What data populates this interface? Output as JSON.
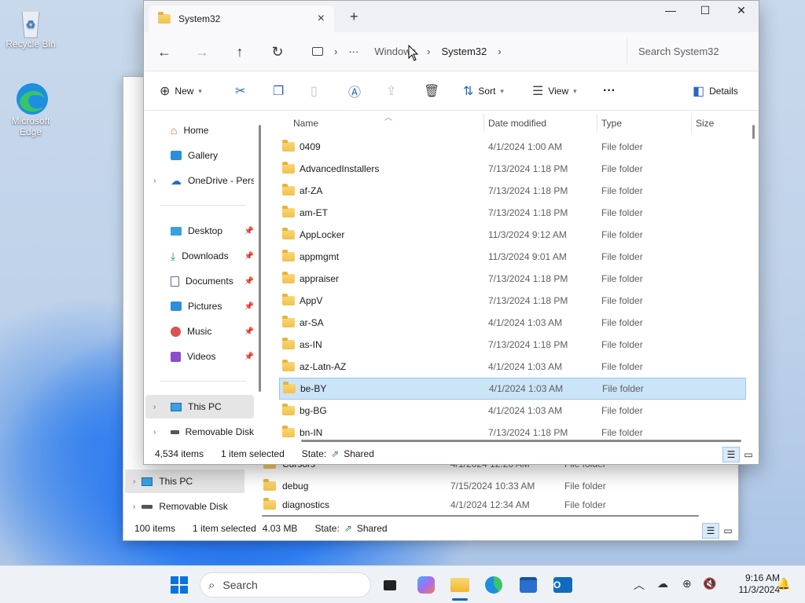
{
  "desktop": {
    "icons": [
      {
        "label": "Recycle Bin",
        "icon": "recycle-bin-icon"
      },
      {
        "label": "Microsoft Edge",
        "icon": "edge-icon"
      }
    ]
  },
  "back_window": {
    "nav": [
      {
        "label": "This PC",
        "icon": "this-pc-icon",
        "selected": true
      },
      {
        "label": "Removable Disk",
        "icon": "drive-icon",
        "selected": false
      }
    ],
    "files": [
      {
        "name": "Cursors",
        "date": "4/1/2024 12:26 AM",
        "type": "File folder"
      },
      {
        "name": "debug",
        "date": "7/15/2024 10:33 AM",
        "type": "File folder"
      },
      {
        "name": "diagnostics",
        "date": "4/1/2024 12:34 AM",
        "type": "File folder"
      }
    ],
    "status": {
      "count": "100 items",
      "selection": "1 item selected",
      "size": "4.03 MB",
      "state_label": "State:",
      "state_value": "Shared"
    }
  },
  "window": {
    "tab_title": "System32",
    "controls": {
      "minimize": "—",
      "maximize": "☐",
      "close": "✕"
    },
    "address": {
      "overflow": "···",
      "crumbs": [
        "Windows",
        "System32"
      ]
    },
    "search_placeholder": "Search System32",
    "toolbar": {
      "new_label": "New",
      "sort_label": "Sort",
      "view_label": "View",
      "more_label": "···",
      "details_label": "Details"
    },
    "nav": {
      "home": "Home",
      "gallery": "Gallery",
      "onedrive": "OneDrive - Personal",
      "desktop": "Desktop",
      "downloads": "Downloads",
      "documents": "Documents",
      "pictures": "Pictures",
      "music": "Music",
      "videos": "Videos",
      "this_pc": "This PC",
      "removable": "Removable Disk"
    },
    "columns": {
      "name": "Name",
      "date": "Date modified",
      "type": "Type",
      "size": "Size"
    },
    "files": [
      {
        "name": "0409",
        "date": "4/1/2024 1:00 AM",
        "type": "File folder"
      },
      {
        "name": "AdvancedInstallers",
        "date": "7/13/2024 1:18 PM",
        "type": "File folder"
      },
      {
        "name": "af-ZA",
        "date": "7/13/2024 1:18 PM",
        "type": "File folder"
      },
      {
        "name": "am-ET",
        "date": "7/13/2024 1:18 PM",
        "type": "File folder"
      },
      {
        "name": "AppLocker",
        "date": "11/3/2024 9:12 AM",
        "type": "File folder"
      },
      {
        "name": "appmgmt",
        "date": "11/3/2024 9:01 AM",
        "type": "File folder"
      },
      {
        "name": "appraiser",
        "date": "7/13/2024 1:18 PM",
        "type": "File folder"
      },
      {
        "name": "AppV",
        "date": "7/13/2024 1:18 PM",
        "type": "File folder"
      },
      {
        "name": "ar-SA",
        "date": "4/1/2024 1:03 AM",
        "type": "File folder"
      },
      {
        "name": "as-IN",
        "date": "7/13/2024 1:18 PM",
        "type": "File folder"
      },
      {
        "name": "az-Latn-AZ",
        "date": "4/1/2024 1:03 AM",
        "type": "File folder"
      },
      {
        "name": "be-BY",
        "date": "4/1/2024 1:03 AM",
        "type": "File folder",
        "selected": true
      },
      {
        "name": "bg-BG",
        "date": "4/1/2024 1:03 AM",
        "type": "File folder"
      },
      {
        "name": "bn-IN",
        "date": "7/13/2024 1:18 PM",
        "type": "File folder"
      }
    ],
    "status": {
      "count": "4,534 items",
      "selection": "1 item selected",
      "state_label": "State:",
      "state_value": "Shared"
    }
  },
  "taskbar": {
    "search_placeholder": "Search",
    "clock_time": "9:16 AM",
    "clock_date": "11/3/2024",
    "accent": "#0067c0"
  }
}
